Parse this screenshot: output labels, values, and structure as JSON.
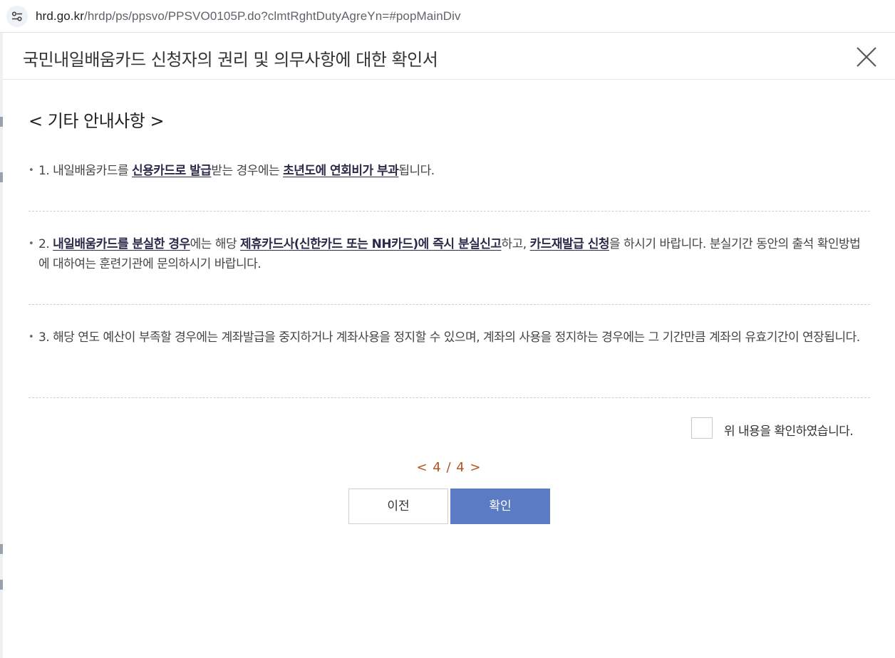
{
  "browser": {
    "url_host": "hrd.go.kr",
    "url_path": "/hrdp/ps/ppsvo/PPSVO0105P.do?clmtRghtDutyAgreYn=#popMainDiv"
  },
  "modal": {
    "title": "국민내일배움카드 신청자의 권리 및 의무사항에 대한 확인서",
    "section_heading": "< 기타 안내사항 >",
    "notices": [
      {
        "bullet": "•",
        "parts": [
          "1. 내일배움카드를 ",
          "신용카드로 발급",
          "받는 경우에는 ",
          "초년도에 연회비가 부과",
          "됩니다."
        ]
      },
      {
        "bullet": "•",
        "parts": [
          "2. ",
          "내일배움카드를 분실한 경우",
          "에는 해당 ",
          "제휴카드사(신한카드 또는 NH카드)에 즉시 분실신고",
          "하고, ",
          "카드재발급 신청",
          "을 하시기 바랍니다. 분실기간 동안의 출석 확인방법에 대하여는 훈련기관에 문의하시기 바랍니다."
        ]
      },
      {
        "bullet": "•",
        "parts": [
          "3. 해당 연도 예산이 부족할 경우에는 계좌발급을 중지하거나 계좌사용을 정지할 수 있으며, 계좌의 사용을 정지하는 경우에는 그 기간만큼 계좌의 유효기간이 연장됩니다."
        ]
      }
    ],
    "confirm_label": "위 내용을 확인하였습니다.",
    "pager": "< 4 / 4 >",
    "prev_button": "이전",
    "ok_button": "확인"
  },
  "icons": {
    "site_info": "tune-icon",
    "close": "close-icon"
  },
  "colors": {
    "pager": "#b5531e",
    "primary_button": "#5b7bc4",
    "emphasis_text": "#2a2a4a"
  }
}
